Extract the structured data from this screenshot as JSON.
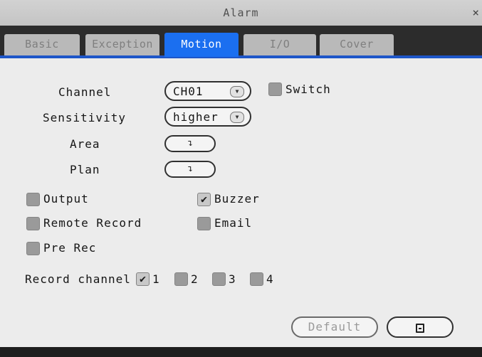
{
  "window": {
    "title": "Alarm",
    "close_glyph": "×"
  },
  "tabs": [
    {
      "label": "Basic"
    },
    {
      "label": "Exception"
    },
    {
      "label": "Motion"
    },
    {
      "label": "I/O"
    },
    {
      "label": "Cover"
    }
  ],
  "active_tab": "Motion",
  "form": {
    "channel_label": "Channel",
    "channel_value": "CH01",
    "switch_label": "Switch",
    "switch_checked": false,
    "sensitivity_label": "Sensitivity",
    "sensitivity_value": "higher",
    "area_label": "Area",
    "plan_label": "Plan",
    "setup_glyph": "↴"
  },
  "options": {
    "output_label": "Output",
    "buzzer_label": "Buzzer",
    "remote_record_label": "Remote Record",
    "email_label": "Email",
    "pre_rec_label": "Pre Rec",
    "check_glyph": "✔",
    "checked": {
      "output": false,
      "buzzer": true,
      "remote_record": false,
      "email": false,
      "pre_rec": false
    }
  },
  "record_channel": {
    "label": "Record channel",
    "channels": [
      {
        "label": "1",
        "checked": true
      },
      {
        "label": "2",
        "checked": false
      },
      {
        "label": "3",
        "checked": false
      },
      {
        "label": "4",
        "checked": false
      }
    ]
  },
  "footer": {
    "default_label": "Default",
    "save_glyph": "💾",
    "save_icon": "floppy-disk-icon"
  },
  "colors": {
    "accent": "#1b6ff0",
    "tab_inactive": "#b9b9b9",
    "checkbox": "#9a9a9a"
  }
}
